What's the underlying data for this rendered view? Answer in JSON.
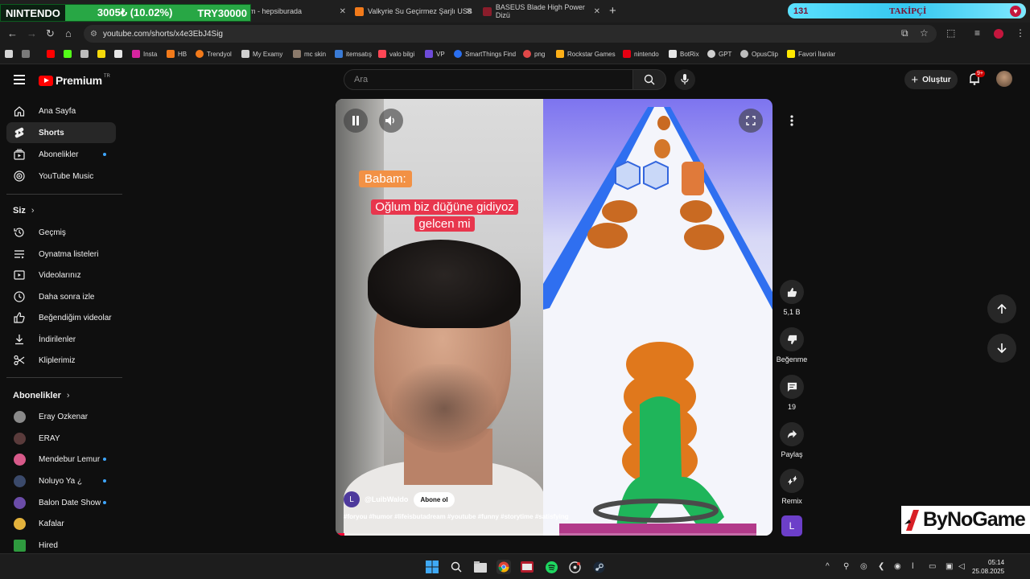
{
  "overlay": {
    "ticker_game": "NINTENDO",
    "ticker_value": "3005₺ (10.02%)",
    "ticker_currency": "TRY30000",
    "follower_count": "131",
    "follower_label": "TAKİPÇİ"
  },
  "browser": {
    "tabs": [
      {
        "title": "em - hepsiburada"
      },
      {
        "title": "Valkyrie Su Geçirmez Şarjlı USB"
      },
      {
        "title": "BASEUS Blade High Power Dizü"
      }
    ],
    "url": "youtube.com/shorts/x4e3EbJ4Sig",
    "bookmarks": [
      "Insta",
      "HB",
      "Trendyol",
      "My Examy",
      "mc skin",
      "itemsatış",
      "valo bilgi",
      "VP",
      "SmartThings Find",
      "png",
      "Rockstar Games",
      "nintendo",
      "BotRix",
      "GPT",
      "OpusClip",
      "Favori İlanlar"
    ]
  },
  "header": {
    "logo": "Premium",
    "logo_region": "TR",
    "search_placeholder": "Ara",
    "create_label": "Oluştur",
    "notification_badge": "9+"
  },
  "sidebar": {
    "main": [
      {
        "label": "Ana Sayfa",
        "icon": "home-icon"
      },
      {
        "label": "Shorts",
        "icon": "shorts-icon"
      },
      {
        "label": "Abonelikler",
        "icon": "subscriptions-icon"
      },
      {
        "label": "YouTube Music",
        "icon": "music-icon"
      }
    ],
    "you_header": "Siz",
    "you": [
      {
        "label": "Geçmiş",
        "icon": "history-icon"
      },
      {
        "label": "Oynatma listeleri",
        "icon": "playlists-icon"
      },
      {
        "label": "Videolarınız",
        "icon": "your-videos-icon"
      },
      {
        "label": "Daha sonra izle",
        "icon": "watch-later-icon"
      },
      {
        "label": "Beğendiğim videolar",
        "icon": "liked-icon"
      },
      {
        "label": "İndirilenler",
        "icon": "download-icon"
      },
      {
        "label": "Kliplerimiz",
        "icon": "clips-icon"
      }
    ],
    "subs_header": "Abonelikler",
    "subscriptions": [
      {
        "label": "Eray Ozkenar",
        "color": "#8a8a8a"
      },
      {
        "label": "ERAY",
        "color": "#5a3b3b"
      },
      {
        "label": "Mendebur Lemur",
        "color": "#d85a8a"
      },
      {
        "label": "Noluyo Ya ¿",
        "color": "#3b4a6b"
      },
      {
        "label": "Balon Date Show",
        "color": "#6b4ca8"
      },
      {
        "label": "Kafalar",
        "color": "#e3b23c"
      },
      {
        "label": "Hired",
        "color": "#2e9a3e"
      }
    ]
  },
  "short": {
    "caption_top": "Babam:",
    "caption_main": "Oğlum biz düğüne gidiyoz gelcen mi",
    "channel_initial": "L",
    "channel": "@LuibWaldo",
    "subscribe_label": "Abone ol",
    "hashtags": "#foryou #humor #lifeisbutadream #youtube #funny #storytime #satisfying",
    "progress": 0.02
  },
  "actions": {
    "like_count": "5,1 B",
    "dislike_label": "Beğenme",
    "comment_count": "19",
    "share_label": "Paylaş",
    "remix_label": "Remix",
    "sound_avatar": "L"
  },
  "watermark": "ByNoGame",
  "taskbar": {
    "time": "05:14",
    "date": "25.08.2025"
  }
}
